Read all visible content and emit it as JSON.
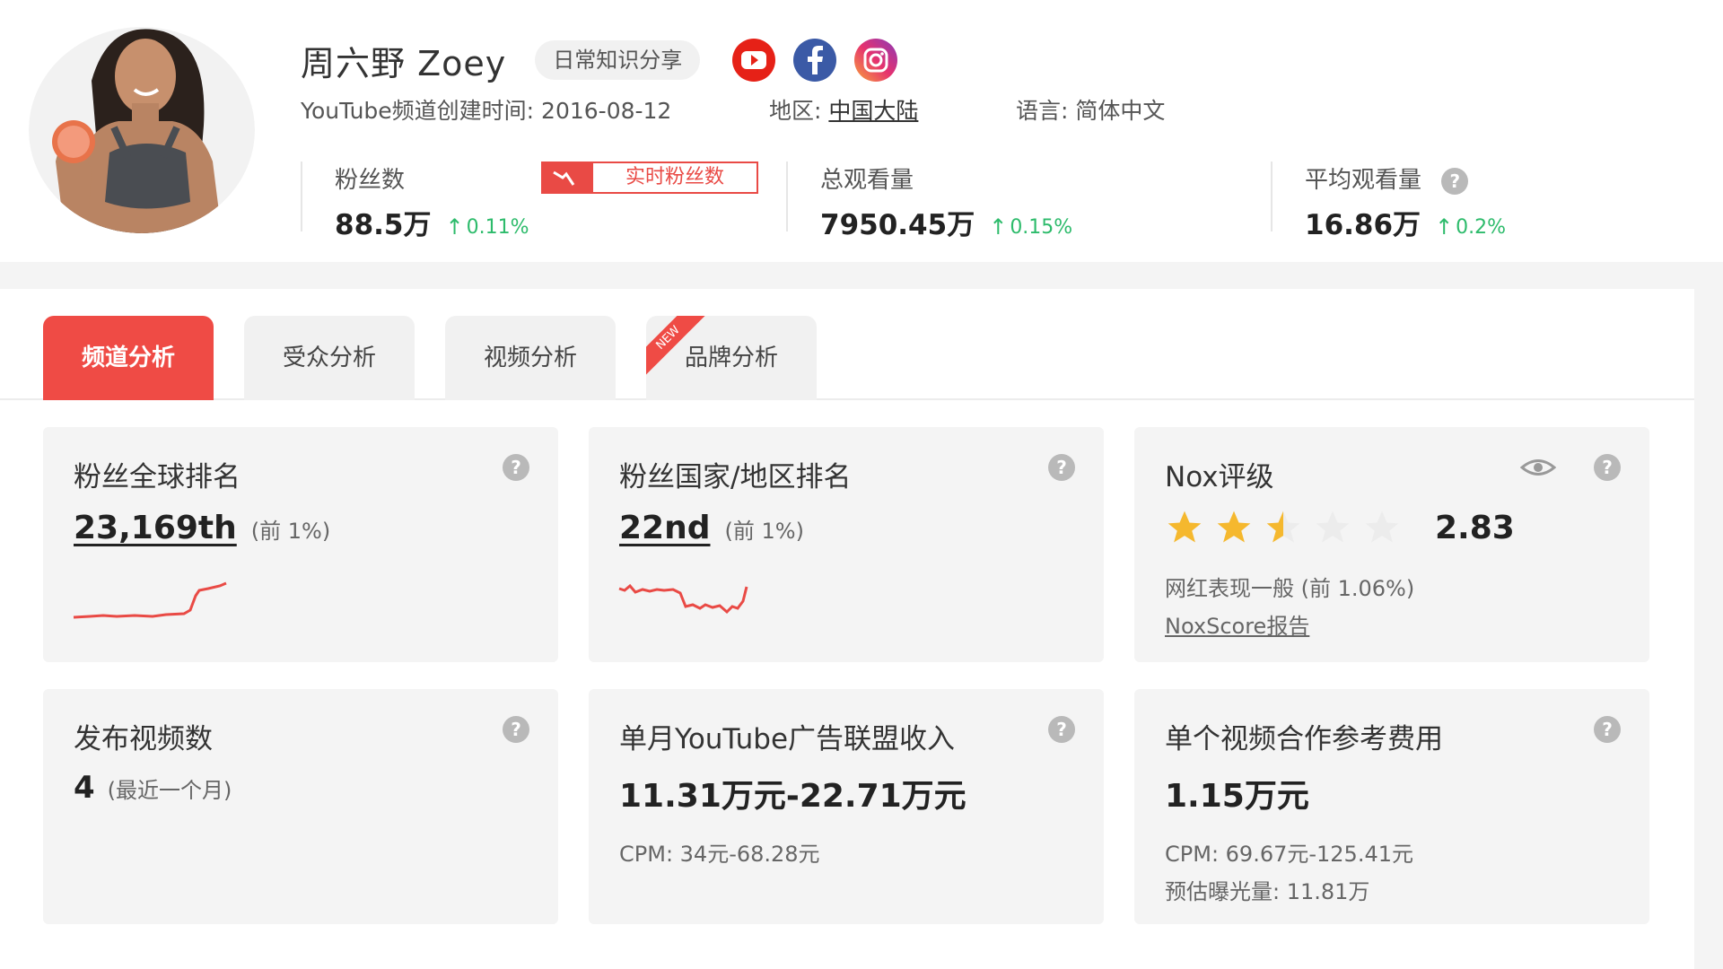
{
  "profile": {
    "name": "周六野 Zoey",
    "tag": "日常知识分享",
    "social": [
      "youtube-icon",
      "facebook-icon",
      "instagram-icon"
    ],
    "created_label": "YouTube频道创建时间:",
    "created_value": "2016-08-12",
    "region_label": "地区:",
    "region_value": "中国大陆",
    "language_label": "语言:",
    "language_value": "简体中文"
  },
  "stats": {
    "followers": {
      "label": "粉丝数",
      "value": "88.5万",
      "change": "0.11%"
    },
    "realtime_button": "实时粉丝数",
    "views": {
      "label": "总观看量",
      "value": "7950.45万",
      "change": "0.15%"
    },
    "avg_views": {
      "label": "平均观看量",
      "value": "16.86万",
      "change": "0.2%"
    }
  },
  "tabs": [
    {
      "label": "频道分析",
      "active": true
    },
    {
      "label": "受众分析",
      "active": false
    },
    {
      "label": "视频分析",
      "active": false
    },
    {
      "label": "品牌分析",
      "active": false,
      "badge": "NEW"
    }
  ],
  "cards": {
    "global_rank": {
      "title": "粉丝全球排名",
      "value": "23,169th",
      "sub": "(前 1%)"
    },
    "country_rank": {
      "title": "粉丝国家/地区排名",
      "value": "22nd",
      "sub": "(前 1%)"
    },
    "nox": {
      "title": "Nox评级",
      "score": "2.83",
      "stars": 2.5,
      "desc": "网红表现一般 (前 1.06%)",
      "link": "NoxScore报告"
    },
    "videos": {
      "title": "发布视频数",
      "value": "4",
      "sub": "(最近一个月)"
    },
    "ad_income": {
      "title": "单月YouTube广告联盟收入",
      "value": "11.31万元-22.71万元",
      "cpm": "CPM: 34元-68.28元"
    },
    "coop_fee": {
      "title": "单个视频合作参考费用",
      "value": "1.15万元",
      "cpm": "CPM: 69.67元-125.41元",
      "exposure": "预估曝光量: 11.81万"
    }
  },
  "colors": {
    "accent": "#ef4b45",
    "up": "#2dbb6b",
    "card_bg": "#f4f4f4",
    "star": "#f5b82e"
  }
}
